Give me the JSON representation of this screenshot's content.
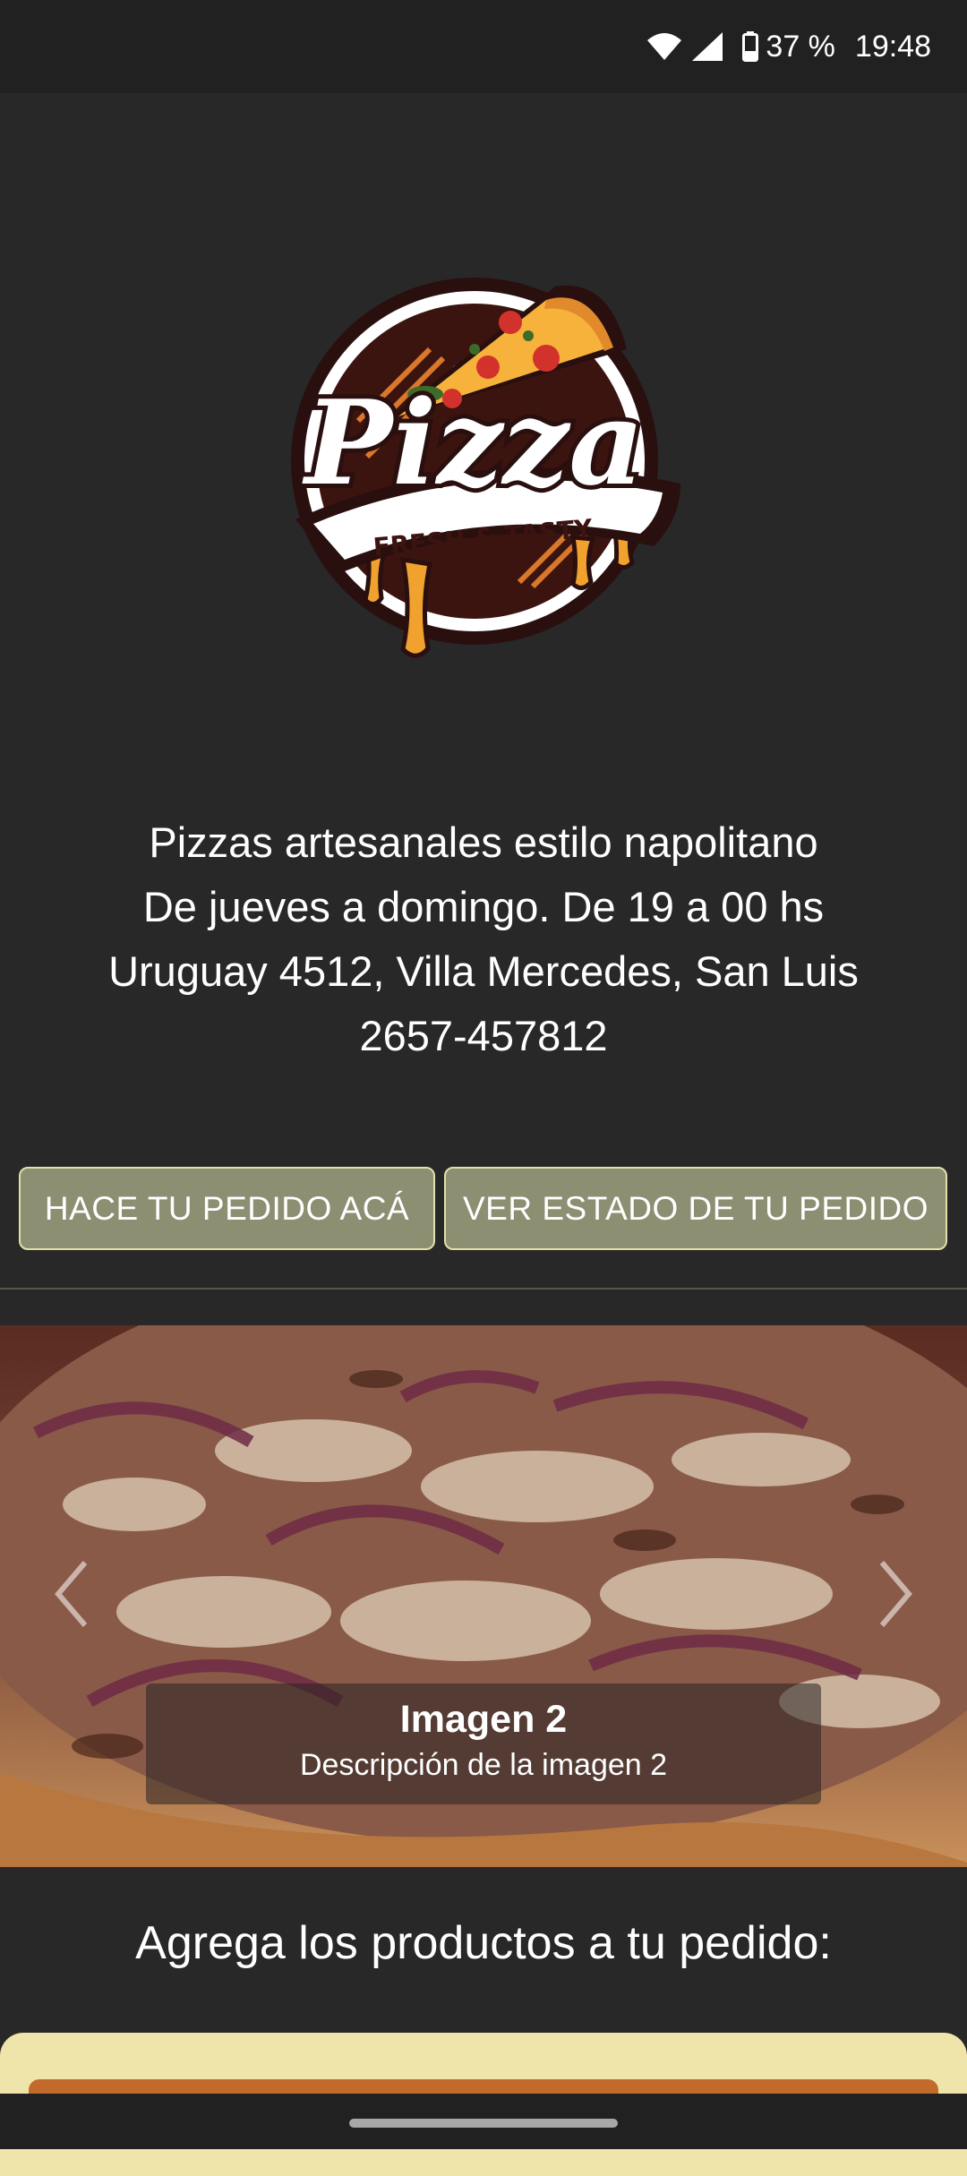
{
  "status_bar": {
    "wifi_icon": "wifi-icon",
    "signal_icon": "signal-icon",
    "battery_icon": "battery-icon",
    "battery_percent": "37 %",
    "time": "19:48"
  },
  "logo": {
    "title": "Pizza",
    "tagline": "FRESH & TASTY"
  },
  "info": {
    "line1": "Pizzas artesanales estilo napolitano",
    "line2": "De jueves a domingo. De 19 a 00 hs",
    "line3": "Uruguay 4512, Villa Mercedes, San Luis",
    "line4": "2657-457812"
  },
  "buttons": {
    "order": "HACE TU PEDIDO ACÁ",
    "status": "VER ESTADO DE TU PEDIDO"
  },
  "carousel": {
    "caption_title": "Imagen 2",
    "caption_description": "Descripción de la imagen 2",
    "prev_icon": "chevron-left-icon",
    "next_icon": "chevron-right-icon"
  },
  "section": {
    "title": "Agrega los productos a tu pedido:"
  },
  "colors": {
    "background": "#282828",
    "button_fill": "#8d8f73",
    "button_border": "#e2e0a8",
    "card_background": "#efe4a9",
    "card_accent": "#c26a2c"
  }
}
